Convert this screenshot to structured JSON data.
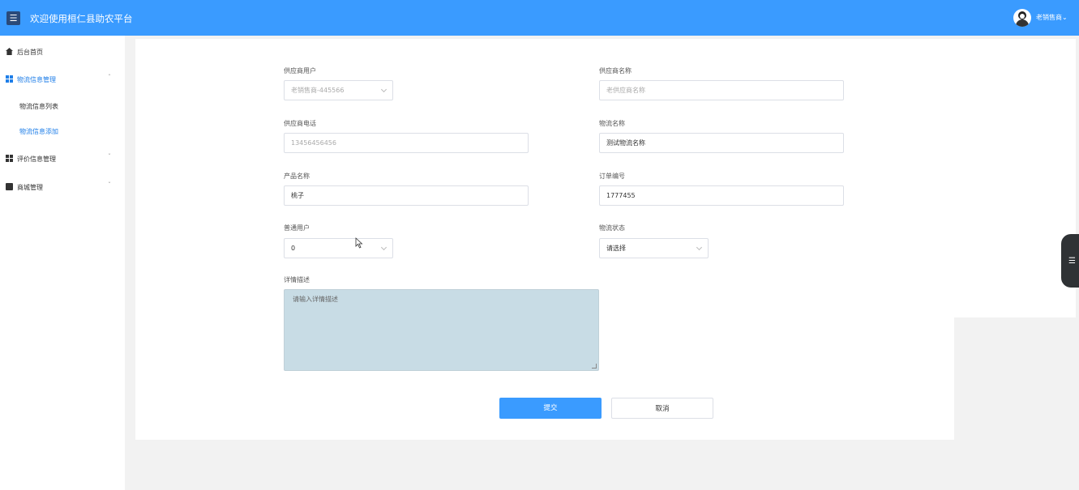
{
  "header": {
    "menu_icon": "☰",
    "title": "欢迎使用桓仁县助农平台",
    "username": "老销售商"
  },
  "sidebar": {
    "items": [
      {
        "label": "后台首页",
        "icon": "home-icon"
      },
      {
        "label": "物流信息管理",
        "icon": "grid-icon",
        "active": true,
        "expanded": true
      },
      {
        "label": "评价信息管理",
        "icon": "grid-icon"
      },
      {
        "label": "商城管理",
        "icon": "box-icon"
      }
    ],
    "sub_items": [
      {
        "label": "物流信息列表"
      },
      {
        "label": "物流信息添加",
        "active": true
      }
    ]
  },
  "form": {
    "supplier_user": {
      "label": "供应商用户",
      "value": "老销售商-445566"
    },
    "supplier_name": {
      "label": "供应商名称",
      "value": "老供应商名称"
    },
    "supplier_phone": {
      "label": "供应商电话",
      "value": "13456456456"
    },
    "logistics_name": {
      "label": "物流名称",
      "value": "测试物流名称"
    },
    "product_name": {
      "label": "产品名称",
      "value": "桃子"
    },
    "order_no": {
      "label": "订单编号",
      "value": "1777455"
    },
    "normal_user": {
      "label": "普通用户",
      "value": "0"
    },
    "logistics_status": {
      "label": "物流状态",
      "value": "请选择"
    },
    "detail": {
      "label": "详情描述",
      "placeholder": "请输入详情描述"
    }
  },
  "actions": {
    "submit": "提交",
    "cancel": "取消"
  },
  "colors": {
    "primary": "#3a9bff",
    "header_menu_btn": "#2a4a7a",
    "textarea_bg": "#c8dce5",
    "active_link": "#1e7ee8"
  }
}
